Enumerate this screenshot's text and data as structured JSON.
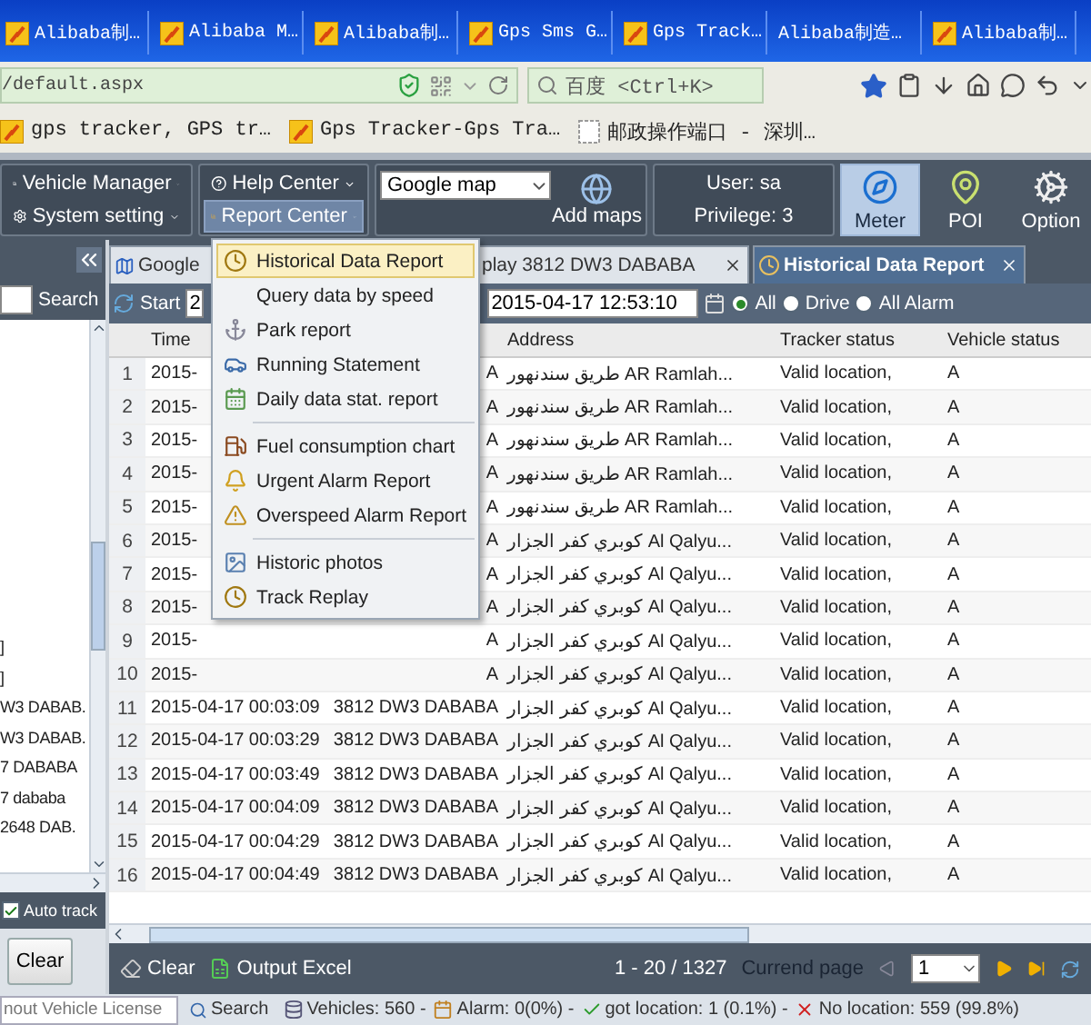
{
  "browser": {
    "tabs": [
      {
        "label": "Alibaba制…",
        "kind": "site"
      },
      {
        "label": "Alibaba M…",
        "kind": "site"
      },
      {
        "label": "Alibaba制…",
        "kind": "site"
      },
      {
        "label": "Gps Sms G…",
        "kind": "site"
      },
      {
        "label": "Gps Track…",
        "kind": "site"
      },
      {
        "label": "Alibaba制造…",
        "kind": "plain"
      },
      {
        "label": "Alibaba制…",
        "kind": "site"
      }
    ],
    "url": "/default.aspx",
    "search_placeholder": "百度 <Ctrl+K>",
    "bookmarks": [
      {
        "label": "gps tracker, GPS tr…",
        "kind": "site"
      },
      {
        "label": "Gps Tracker-Gps Tra…",
        "kind": "site"
      },
      {
        "label": "邮政操作端口 - 深圳…",
        "kind": "blank"
      }
    ]
  },
  "toolbar": {
    "menus": [
      {
        "label": "Vehicle Manager",
        "kind": "vehicle",
        "selected": false
      },
      {
        "label": "System setting",
        "kind": "settings",
        "selected": false
      },
      {
        "label": "Help Center",
        "kind": "help",
        "selected": false
      },
      {
        "label": "Report Center",
        "kind": "report",
        "selected": true
      }
    ],
    "map_select": "Google map",
    "add_maps": "Add maps",
    "user": "User: sa",
    "privilege": "Privilege: 3",
    "tools": [
      {
        "label": "Meter",
        "kind": "meter",
        "selected": true
      },
      {
        "label": "POI",
        "kind": "poi",
        "selected": false
      },
      {
        "label": "Option",
        "kind": "option",
        "selected": false
      }
    ]
  },
  "report_menu": {
    "groups": [
      [
        {
          "label": "Historical Data Report",
          "kind": "clock",
          "selected": true
        },
        {
          "label": "Query data by speed",
          "kind": "none",
          "selected": false
        },
        {
          "label": "Park report",
          "kind": "anchor",
          "selected": false
        },
        {
          "label": "Running Statement",
          "kind": "car",
          "selected": false
        },
        {
          "label": "Daily data stat. report",
          "kind": "calendar",
          "selected": false
        }
      ],
      [
        {
          "label": "Fuel consumption chart",
          "kind": "fuel",
          "selected": false
        },
        {
          "label": "Urgent Alarm Report",
          "kind": "bell",
          "selected": false
        },
        {
          "label": "Overspeed Alarm Report",
          "kind": "warning",
          "selected": false
        }
      ],
      [
        {
          "label": "Historic photos",
          "kind": "photo",
          "selected": false
        },
        {
          "label": "Track Replay",
          "kind": "clock",
          "selected": false
        }
      ]
    ]
  },
  "left_panel": {
    "search_button": "Search",
    "vehicles": [
      "]",
      "]",
      "W3 DABAB.",
      "W3 DABAB.",
      "7 DABABA",
      "7 dababa",
      "2648 DAB."
    ],
    "auto_track": {
      "label": "Auto track",
      "checked": true
    },
    "clear_button": "Clear"
  },
  "content_tabs": [
    {
      "label": "Google",
      "kind": "map",
      "selected": false,
      "closable": false
    },
    {
      "label": "play 3812 DW3 DABABA",
      "kind": "plain",
      "selected": false,
      "closable": true
    },
    {
      "label": "Historical Data Report",
      "kind": "clock",
      "selected": true,
      "closable": true
    }
  ],
  "filter": {
    "start_label": "Start",
    "start_value": "2",
    "end_value": "2015-04-17 12:53:10",
    "radios": [
      {
        "label": "All",
        "selected": true
      },
      {
        "label": "Drive",
        "selected": false
      },
      {
        "label": "All Alarm",
        "selected": false
      }
    ]
  },
  "table": {
    "headers": {
      "time": "Time",
      "address": "Address",
      "tracker": "Tracker status",
      "vehicle_status": "Vehicle status"
    },
    "rows": [
      {
        "no": "1",
        "time": "2015-",
        "vehicle": "A",
        "address": "طريق سندنهور AR Ramlah...",
        "tracker": "Valid location,",
        "vehicle_status": "A"
      },
      {
        "no": "2",
        "time": "2015-",
        "vehicle": "A",
        "address": "طريق سندنهور AR Ramlah...",
        "tracker": "Valid location,",
        "vehicle_status": "A"
      },
      {
        "no": "3",
        "time": "2015-",
        "vehicle": "A",
        "address": "طريق سندنهور AR Ramlah...",
        "tracker": "Valid location,",
        "vehicle_status": "A"
      },
      {
        "no": "4",
        "time": "2015-",
        "vehicle": "A",
        "address": "طريق سندنهور AR Ramlah...",
        "tracker": "Valid location,",
        "vehicle_status": "A"
      },
      {
        "no": "5",
        "time": "2015-",
        "vehicle": "A",
        "address": "طريق سندنهور AR Ramlah...",
        "tracker": "Valid location,",
        "vehicle_status": "A"
      },
      {
        "no": "6",
        "time": "2015-",
        "vehicle": "A",
        "address": "كوبري كفر الجزار Al Qalyu...",
        "tracker": "Valid location,",
        "vehicle_status": "A"
      },
      {
        "no": "7",
        "time": "2015-",
        "vehicle": "A",
        "address": "كوبري كفر الجزار Al Qalyu...",
        "tracker": "Valid location,",
        "vehicle_status": "A"
      },
      {
        "no": "8",
        "time": "2015-",
        "vehicle": "A",
        "address": "كوبري كفر الجزار Al Qalyu...",
        "tracker": "Valid location,",
        "vehicle_status": "A"
      },
      {
        "no": "9",
        "time": "2015-",
        "vehicle": "A",
        "address": "كوبري كفر الجزار Al Qalyu...",
        "tracker": "Valid location,",
        "vehicle_status": "A"
      },
      {
        "no": "10",
        "time": "2015-",
        "vehicle": "A",
        "address": "كوبري كفر الجزار Al Qalyu...",
        "tracker": "Valid location,",
        "vehicle_status": "A"
      },
      {
        "no": "11",
        "time": "2015-04-17 00:03:09",
        "vehicle": "3812 DW3 DABABA",
        "address": "كوبري كفر الجزار Al Qalyu...",
        "tracker": "Valid location,",
        "vehicle_status": "A"
      },
      {
        "no": "12",
        "time": "2015-04-17 00:03:29",
        "vehicle": "3812 DW3 DABABA",
        "address": "كوبري كفر الجزار Al Qalyu...",
        "tracker": "Valid location,",
        "vehicle_status": "A"
      },
      {
        "no": "13",
        "time": "2015-04-17 00:03:49",
        "vehicle": "3812 DW3 DABABA",
        "address": "كوبري كفر الجزار Al Qalyu...",
        "tracker": "Valid location,",
        "vehicle_status": "A"
      },
      {
        "no": "14",
        "time": "2015-04-17 00:04:09",
        "vehicle": "3812 DW3 DABABA",
        "address": "كوبري كفر الجزار Al Qalyu...",
        "tracker": "Valid location,",
        "vehicle_status": "A"
      },
      {
        "no": "15",
        "time": "2015-04-17 00:04:29",
        "vehicle": "3812 DW3 DABABA",
        "address": "كوبري كفر الجزار Al Qalyu...",
        "tracker": "Valid location,",
        "vehicle_status": "A"
      },
      {
        "no": "16",
        "time": "2015-04-17 00:04:49",
        "vehicle": "3812 DW3 DABABA",
        "address": "كوبري كفر الجزار Al Qalyu...",
        "tracker": "Valid location,",
        "vehicle_status": "A"
      }
    ]
  },
  "table_footer": {
    "clear": "Clear",
    "export": "Output Excel",
    "range": "1 - 20 / 1327",
    "page_label": "Currend page",
    "page_value": "1"
  },
  "status_bar": {
    "search_placeholder": "nout Vehicle License",
    "search_button": "Search",
    "stats": [
      {
        "kind": "vehicles",
        "text": "Vehicles: 560 -"
      },
      {
        "kind": "alarm",
        "text": "Alarm: 0(0%) -"
      },
      {
        "kind": "ok",
        "text": "got location: 1 (0.1%) -"
      },
      {
        "kind": "none",
        "text": "No location: 559 (99.8%)"
      }
    ]
  }
}
